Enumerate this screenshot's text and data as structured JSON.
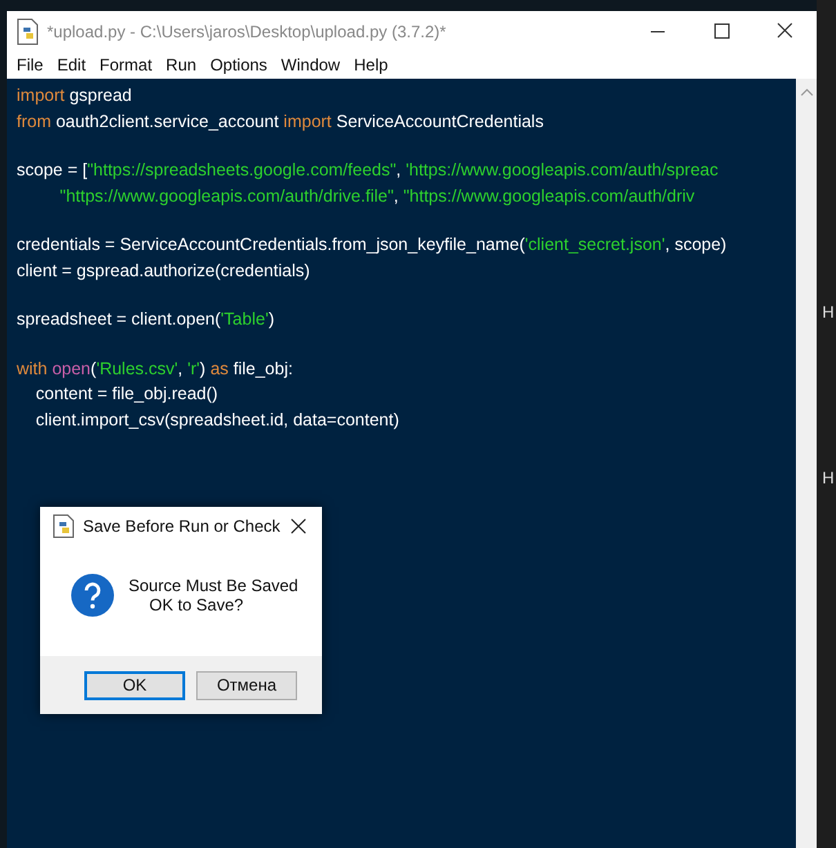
{
  "window": {
    "title": "*upload.py - C:\\Users\\jaros\\Desktop\\upload.py (3.7.2)*"
  },
  "menu": [
    "File",
    "Edit",
    "Format",
    "Run",
    "Options",
    "Window",
    "Help"
  ],
  "code": {
    "blocks": [
      [
        [
          {
            "kind": "keyword",
            "text": "import"
          },
          {
            "kind": "plain",
            "text": " gspread"
          }
        ],
        [
          {
            "kind": "keyword",
            "text": "from"
          },
          {
            "kind": "plain",
            "text": " oauth2client.service_account "
          },
          {
            "kind": "keyword",
            "text": "import"
          },
          {
            "kind": "plain",
            "text": " ServiceAccountCredentials"
          }
        ]
      ],
      [
        [
          {
            "kind": "plain",
            "text": "scope = ["
          },
          {
            "kind": "string",
            "text": "\"https://spreadsheets.google.com/feeds\""
          },
          {
            "kind": "plain",
            "text": ", "
          },
          {
            "kind": "string",
            "text": "'https://www.googleapis.com/auth/spreac"
          }
        ],
        [
          {
            "kind": "string",
            "text": "         \"https://www.googleapis.com/auth/drive.file\""
          },
          {
            "kind": "plain",
            "text": ", "
          },
          {
            "kind": "string",
            "text": "\"https://www.googleapis.com/auth/driv"
          }
        ]
      ],
      [
        [
          {
            "kind": "plain",
            "text": "credentials = ServiceAccountCredentials.from_json_keyfile_name("
          },
          {
            "kind": "string",
            "text": "'client_secret.json'"
          },
          {
            "kind": "plain",
            "text": ", scope)"
          }
        ],
        [
          {
            "kind": "plain",
            "text": "client = gspread.authorize(credentials)"
          }
        ]
      ],
      [
        [
          {
            "kind": "plain",
            "text": "spreadsheet = client.open("
          },
          {
            "kind": "string",
            "text": "'Table'"
          },
          {
            "kind": "plain",
            "text": ")"
          }
        ]
      ],
      [
        [
          {
            "kind": "keyword",
            "text": "with "
          },
          {
            "kind": "builtin",
            "text": "open"
          },
          {
            "kind": "plain",
            "text": "("
          },
          {
            "kind": "string",
            "text": "'Rules.csv'"
          },
          {
            "kind": "plain",
            "text": ", "
          },
          {
            "kind": "string",
            "text": "'r'"
          },
          {
            "kind": "plain",
            "text": ") "
          },
          {
            "kind": "keyword",
            "text": "as"
          },
          {
            "kind": "plain",
            "text": " file_obj:"
          }
        ],
        [
          {
            "kind": "plain",
            "text": "    content = file_obj.read()"
          }
        ],
        [
          {
            "kind": "plain",
            "text": "    client.import_csv(spreadsheet.id, data=content)"
          }
        ]
      ]
    ]
  },
  "dialog": {
    "title": "Save Before Run or Check",
    "message": [
      "Source Must Be Saved",
      "OK to Save?"
    ],
    "buttons": [
      {
        "label": "OK",
        "default": true
      },
      {
        "label": "Отмена",
        "default": false
      }
    ]
  },
  "background_window": {
    "texts": [
      "H",
      "H"
    ]
  }
}
